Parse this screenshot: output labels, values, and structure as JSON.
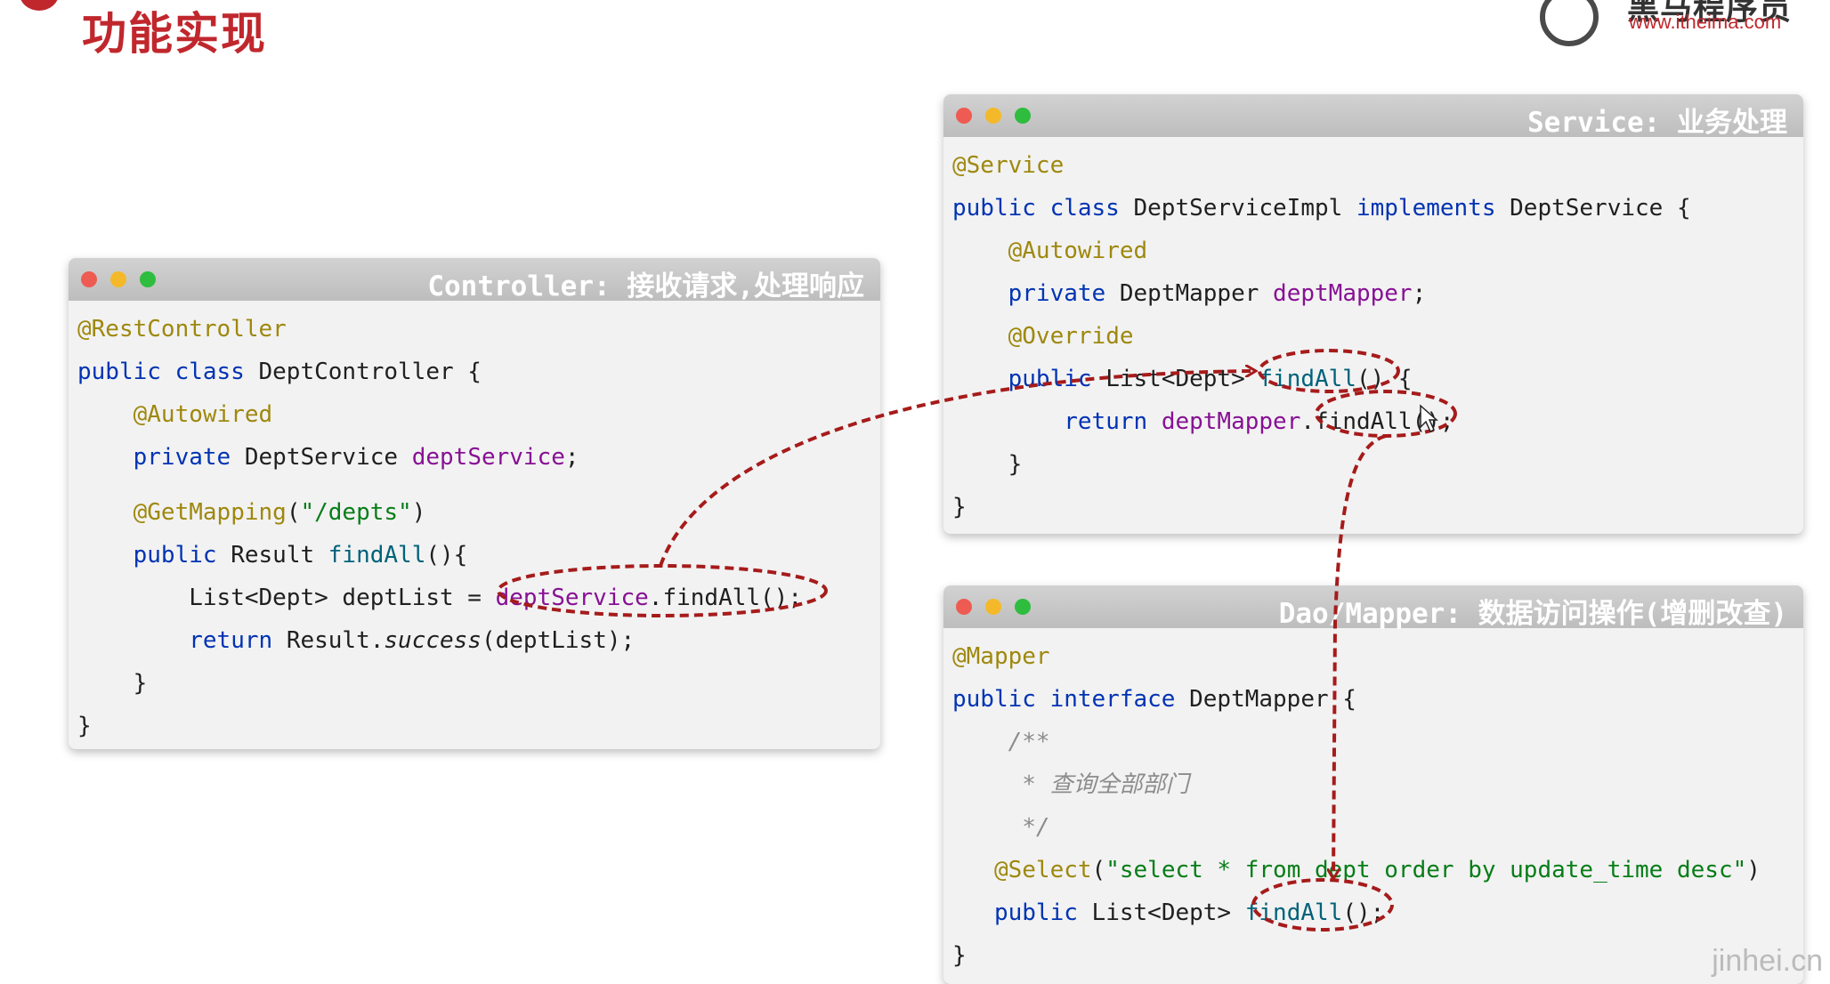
{
  "header": {
    "title": "功能实现",
    "logo_name": "黑马程序员",
    "logo_url": "www.itheima.com"
  },
  "colors": {
    "accent_red": "#c0272d",
    "annotation": "#9e880d",
    "keyword": "#0033b3",
    "field": "#871094",
    "string": "#067d17",
    "arrow": "#a61b1b"
  },
  "controller": {
    "title": "Controller: 接收请求,处理响应",
    "l1": "@RestController",
    "l2_kw": "public class ",
    "l2_rest": "DeptController {",
    "l3": "@Autowired",
    "l4_kw": "private ",
    "l4_type": "DeptService ",
    "l4_field": "deptService",
    "l4_end": ";",
    "l5_ann": "@GetMapping",
    "l5_p1": "(",
    "l5_str": "\"/depts\"",
    "l5_p2": ")",
    "l6_kw": "public ",
    "l6_type": "Result ",
    "l6_fn": "findAll",
    "l6_end": "(){",
    "l7_a": "List<Dept> deptList = ",
    "l7_field": "deptService",
    "l7_call": ".findAll();",
    "l8_kw": "return ",
    "l8_a": "Result.",
    "l8_it": "success",
    "l8_b": "(deptList);",
    "l9": "}",
    "l10": "}"
  },
  "service": {
    "title": "Service: 业务处理",
    "l1": "@Service",
    "l2_kw1": "public class ",
    "l2_a": "DeptServiceImpl ",
    "l2_kw2": "implements ",
    "l2_b": "DeptService {",
    "l3": "@Autowired",
    "l4_kw": "private ",
    "l4_type": "DeptMapper ",
    "l4_field": "deptMapper",
    "l4_end": ";",
    "l5": "@Override",
    "l6_kw": "public ",
    "l6_type": "List<Dept> ",
    "l6_fn": "findAll",
    "l6_end": "() {",
    "l7_kw": "return ",
    "l7_field": "deptMapper",
    "l7_call": ".findAll();",
    "l8": "}",
    "l9": "}"
  },
  "mapper": {
    "title": "Dao/Mapper: 数据访问操作(增删改查)",
    "l1": "@Mapper",
    "l2_kw": "public interface ",
    "l2_rest": "DeptMapper {",
    "c1": "/**",
    "c2": " * 查询全部部门",
    "c3": " */",
    "l3_ann": "@Select",
    "l3_p1": "(",
    "l3_str": "\"select * from dept order by update_time desc\"",
    "l3_p2": ")",
    "l4_kw": "public ",
    "l4_type": "List<Dept> ",
    "l4_fn": "findAll",
    "l4_end": "();",
    "l5": "}"
  },
  "watermark": "jinhei.cn"
}
